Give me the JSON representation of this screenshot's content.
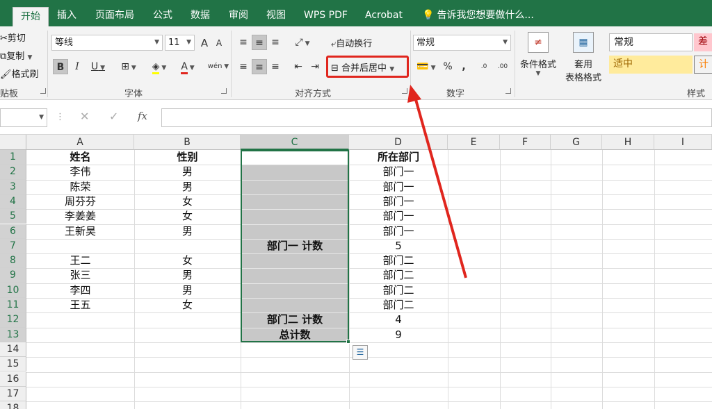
{
  "tabs": [
    "开始",
    "插入",
    "页面布局",
    "公式",
    "数据",
    "审阅",
    "视图",
    "WPS PDF",
    "Acrobat"
  ],
  "tell_me": "告诉我您想要做什么...",
  "clipboard": {
    "cut": "剪切",
    "copy": "复制",
    "format_painter": "格式刷",
    "label": "剪贴板",
    "label_visible": "贴板"
  },
  "font": {
    "name": "等线",
    "size": "11",
    "label": "字体",
    "grow": "A",
    "shrink": "A",
    "bold": "B",
    "italic": "I",
    "underline": "U",
    "color_letter": "A",
    "phonetic": "wén"
  },
  "alignment": {
    "wrap": "自动换行",
    "merge": "合并后居中",
    "label": "对齐方式"
  },
  "number": {
    "format": "常规",
    "percent": "%",
    "comma": ",",
    "label": "数字",
    "inc_decimal": ".0",
    "dec_decimal": ".00"
  },
  "styles": {
    "cond_format": "条件格式",
    "table_format_1": "套用",
    "table_format_2": "表格格式",
    "normal": "常规",
    "bad": "差",
    "neutral": "适中",
    "calc": "计",
    "label": "样式"
  },
  "formula_bar": {
    "fx": "fx",
    "cancel": "✕",
    "enter": "✓",
    "value": ""
  },
  "columns": [
    "A",
    "B",
    "C",
    "D",
    "E",
    "F",
    "G",
    "H",
    "I"
  ],
  "rows": [
    "1",
    "2",
    "3",
    "4",
    "5",
    "6",
    "7",
    "8",
    "9",
    "10",
    "11",
    "12",
    "13",
    "14",
    "15",
    "16",
    "17",
    "18"
  ],
  "cells": {
    "A1": "姓名",
    "B1": "性别",
    "D1": "所在部门",
    "A2": "李伟",
    "B2": "男",
    "D2": "部门一",
    "A3": "陈荣",
    "B3": "男",
    "D3": "部门一",
    "A4": "周芬芬",
    "B4": "女",
    "D4": "部门一",
    "A5": "李姜姜",
    "B5": "女",
    "D5": "部门一",
    "A6": "王新昊",
    "B6": "男",
    "D6": "部门一",
    "C7": "部门一 计数",
    "D7": "5",
    "A8": "王二",
    "B8": "女",
    "D8": "部门二",
    "A9": "张三",
    "B9": "男",
    "D9": "部门二",
    "A10": "李四",
    "B10": "男",
    "D10": "部门二",
    "A11": "王五",
    "B11": "女",
    "D11": "部门二",
    "C12": "部门二 计数",
    "D12": "4",
    "C13": "总计数",
    "D13": "9"
  },
  "colors": {
    "accent": "#217346",
    "highlight_red": "#e0261e",
    "selection_gray": "#c8c8c8",
    "neutral_bg": "#ffeb9c",
    "bad_bg": "#ffc7ce"
  }
}
